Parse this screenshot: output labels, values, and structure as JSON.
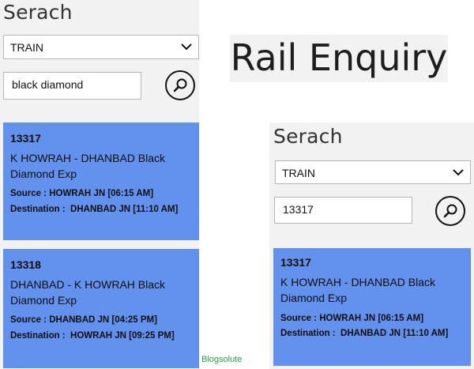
{
  "app_title": "Rail Enquiry",
  "watermark": "Blogsolute",
  "left": {
    "heading": "Serach",
    "type_select": "TRAIN",
    "search_value": "black diamond",
    "results": [
      {
        "number": "13317",
        "name": "K HOWRAH - DHANBAD Black Diamond Exp",
        "source": "Source : HOWRAH JN [06:15 AM]",
        "destination": "Destination :  DHANBAD JN [11:10 AM]"
      },
      {
        "number": "13318",
        "name": "DHANBAD - K HOWRAH Black Diamond Exp",
        "source": "Source : DHANBAD JN [04:25 PM]",
        "destination": "Destination :  HOWRAH JN [09:25 PM]"
      }
    ]
  },
  "right": {
    "heading": "Serach",
    "type_select": "TRAIN",
    "search_value": "13317",
    "results": [
      {
        "number": "13317",
        "name": "K HOWRAH - DHANBAD Black Diamond Exp",
        "source": "Source : HOWRAH JN [06:15 AM]",
        "destination": "Destination :  DHANBAD JN [11:10 AM]"
      }
    ]
  },
  "colors": {
    "panel_bg": "#f2f2f2",
    "card_bg": "#6392ee",
    "watermark": "#2e9a47"
  },
  "icons": {
    "search": "search-icon",
    "dropdown": "chevron-down-icon"
  }
}
